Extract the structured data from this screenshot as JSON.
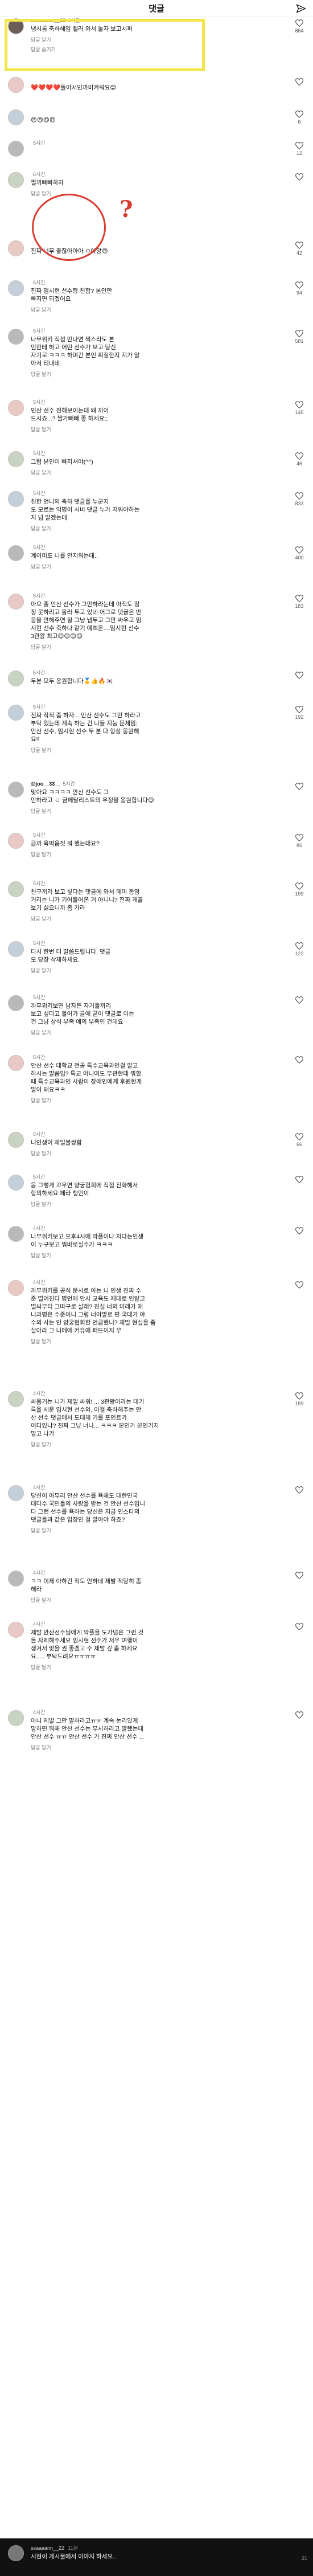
{
  "header": {
    "title": "댓글"
  },
  "side_icons": [
    "♡",
    "💬",
    "↻",
    "…"
  ],
  "comments": [
    {
      "user": "ssaaaann__22",
      "time": "6시간",
      "text": "냉시롱 축하해임 뻘러 와서 놀자 보고시퍼",
      "reply": "답글 달기",
      "more": "답글 숨기기",
      "likes": "864",
      "avatar": "dark",
      "blur": false
    },
    {
      "user": "",
      "time": "",
      "text": "❤️❤️❤️❤️돌아서인까미켜워요😊",
      "reply": "",
      "more": "",
      "likes": "",
      "avatar": "pink",
      "blur": false
    },
    {
      "user": "",
      "time": "",
      "text": "😍😍😍😍",
      "reply": "",
      "more": "",
      "likes": "6",
      "avatar": "blue",
      "blur": false
    },
    {
      "user": "",
      "time": "5시간",
      "text": "",
      "reply": "",
      "more": "",
      "likes": "12",
      "avatar": "gray",
      "blur": true
    },
    {
      "user": "",
      "time": "6시간",
      "text": "찔끼빠빠하자",
      "reply": "답글 달기",
      "more": "",
      "likes": "",
      "avatar": "green",
      "blur": true
    },
    {
      "user": "",
      "time": "",
      "text": "진짜 너무 좋잖아아아 ㅇ아앙😍",
      "reply": "",
      "more": "",
      "likes": "42",
      "avatar": "pink",
      "blur": true
    },
    {
      "user": "",
      "time": "6시간",
      "text": "진짜 임시현 선수랑 친함? 본인만\n빠지면 되겠어요",
      "reply": "답글 달기",
      "more": "",
      "likes": "94",
      "avatar": "blue",
      "blur": true
    },
    {
      "user": "",
      "time": "5시간",
      "text": "나무위키 직접 만나면 찍스라도 본\n인한테 하고 어떤 선수가 보고 당신\n자기로 ㅋㅋㅋ 하며간 본인 찌질한지 지가 알\n아서 티내네",
      "reply": "답글 달기",
      "more": "",
      "likes": "581",
      "avatar": "gray",
      "blur": true
    },
    {
      "user": "",
      "time": "5시간",
      "text": "인산 선수 진해보이는데 왜 끼어\n드시죠...? 짤가빼빼 좋 하세요;;",
      "reply": "답글 달기",
      "more": "",
      "likes": "145",
      "avatar": "pink",
      "blur": true
    },
    {
      "user": "",
      "time": "5시간",
      "text": "그럼 본인이 빠지셔야(^^)",
      "reply": "답글 달기",
      "more": "",
      "likes": "46",
      "avatar": "green",
      "blur": true
    },
    {
      "user": "",
      "time": "5시간",
      "text": "친한 언니의 축하 댓글을 누군지\n도 모르는 익명이 시비 댓글 누가 지워야하는\n지 넘 알겠는데",
      "reply": "답글 달기",
      "more": "",
      "likes": "833",
      "avatar": "blue",
      "blur": true
    },
    {
      "user": "",
      "time": "5시간",
      "text": "계이미도 니를 안지워는데..",
      "reply": "답글 달기",
      "more": "",
      "likes": "400",
      "avatar": "gray",
      "blur": true
    },
    {
      "user": "",
      "time": "5시간",
      "text": "아오 졸 안산 선수가 그만하라는데 아직도 징\n징 못하리고 몰라 투고 있네 어그로 댓글은 반\n응을 안해주면 될 그냥 냅두고 그만 싸우고 임\n시현 선수 축하나 같기 예쁘은....임시현 선수\n3관왕 최고😊😊😊😊",
      "reply": "답글 달기",
      "more": "",
      "likes": "183",
      "avatar": "pink",
      "blur": true
    },
    {
      "user": "",
      "time": "5시간",
      "text": "두분 모두 응원합니다🥇👍🔥🇰🇷",
      "reply": "",
      "more": "",
      "likes": "",
      "avatar": "green",
      "blur": true
    },
    {
      "user": "",
      "time": "5시간",
      "text": "진짜 작작 좀 하자... 안산 선수도 그만 하라고\n부탁 했는데 계속 하는 건 니들 지능 문제임;\n안산 선수, 임시현 선수 두 분 다 항상 응원해\n요!!",
      "reply": "답글 달기",
      "more": "",
      "likes": "192",
      "avatar": "blue",
      "blur": true
    },
    {
      "user": "@joo__33__",
      "time": "5시간",
      "text": "맞아요 ㅋㅋㅋㅋ 안산 선수도 그\n만하라고 ☺ 금메달리스트의 우정을 응원합니다😊",
      "reply": "답글 달기",
      "more": "",
      "likes": "",
      "avatar": "gray",
      "blur": false
    },
    {
      "user": "",
      "time": "5시간",
      "text": "금까 욕먹음짓 뭐 했는데요?",
      "reply": "답글 달기",
      "more": "",
      "likes": "86",
      "avatar": "pink",
      "blur": true
    },
    {
      "user": "",
      "time": "5시간",
      "text": "친구끼리 보고 싶다는 댓글에 와서 페미 동영\n거리는 니가 기어들어온 거 아니니? 진짜 게꼴\n보기 싫으니까 좀 가라",
      "reply": "답글 달기",
      "more": "",
      "likes": "199",
      "avatar": "green",
      "blur": true
    },
    {
      "user": "",
      "time": "5시간",
      "text": "다시 한번 더 말씀드립니다. 댓글\n모 당장 삭제하세요.",
      "reply": "답글 달기",
      "more": "",
      "likes": "122",
      "avatar": "blue",
      "blur": true
    },
    {
      "user": "",
      "time": "5시간",
      "text": "까무위키보면 남자든 자기들끼리\n보고 싶다고 들어가 글에 굳이 댓글로 이는\n건 그냥 상식 부족 예의 부족인 건데요",
      "reply": "답글 달기",
      "more": "",
      "likes": "",
      "avatar": "gray",
      "blur": true
    },
    {
      "user": "",
      "time": "5시간",
      "text": "안산 선수 대학교 전공 특수교육과인걸 알고\n하시는 말씀임? 특교 아니여도 무관한데 뭐할\n때 특수교육과인 사람이 장애인에게 후원한게\n말이 돼요ㅋㅋ",
      "reply": "답글 달기",
      "more": "",
      "likes": "",
      "avatar": "pink",
      "blur": true
    },
    {
      "user": "",
      "time": "5시간",
      "text": "니인생이 제일불쌍함",
      "reply": "답글 달기",
      "more": "",
      "likes": "66",
      "avatar": "green",
      "blur": true
    },
    {
      "user": "",
      "time": "5시간",
      "text": "음 그렇게 꼬우면 양궁협회에 직접 전화해서\n항의하세요 페라 챙인이",
      "reply": "답글 달기",
      "more": "",
      "likes": "",
      "avatar": "blue",
      "blur": true
    },
    {
      "user": "",
      "time": "4시간",
      "text": "나무위키보고 오후4시에 악플이나 처다는인생\n이 누구보고 뭐바로실수가 ㅋㅋㅋ",
      "reply": "답글 달기",
      "more": "",
      "likes": "",
      "avatar": "gray",
      "blur": true
    },
    {
      "user": "",
      "time": "4시간",
      "text": "까무위키를 공식 문서로 아는 니 인생 진짜 수\n준 떨어진다 명언에 안사 교육도 제대로 인받고\n벌써부터 그따구로 살래? 진심 너의 미래가 애\n니과명은 수준이니 그럼 너야말로 편 국대가 야\n수의 사는 인 양궁협회한 언급했니? 제발 현실을 좀\n살아라 그 니에에 커유에 퍼뜨이지 우",
      "reply": "답글 달기",
      "more": "",
      "likes": "",
      "avatar": "pink",
      "blur": true
    },
    {
      "user": "",
      "time": "4시간",
      "text": "싸움거는 니가 제일 싸워! ... 3관왕이라는 대기\n록을 세운 임시현 선수와, 이걸 축하해주는 안\n산 선수 댓글에서 도대체 기를 포인트가\n어디있냐? 진짜 그냥 너나... ㅋㅋㅋ 본인가 본인거지\n말고 나가",
      "reply": "답글 달기",
      "more": "",
      "likes": "159",
      "avatar": "green",
      "blur": true
    },
    {
      "user": "",
      "time": "4시간",
      "text": "당신이 아무리 안산 선수를 욕해도 대한민국\n대다수 국민들의 사랑을 받는 건 안산 선수입니\n다 그런 선수를 욕하는 당신은 지금 인스타의\n댓글들과 같은 입장인 걸 알아야 하죠?",
      "reply": "답글 달기",
      "more": "",
      "likes": "",
      "avatar": "blue",
      "blur": true
    },
    {
      "user": "",
      "time": "4시간",
      "text": "ㅋㅋ 이제 아하긴 적도 안하네 제발 적당히 좀\n해라",
      "reply": "답글 달기",
      "more": "",
      "likes": "",
      "avatar": "gray",
      "blur": true
    },
    {
      "user": "",
      "time": "4시간",
      "text": "제발 안산선수님에게 악플을 도가넘은 그런 것\n들 자제해주세요 임시현 선수가 저우 여행이\n생겨서 맞을 권 좋겠고 수 제발 깊 좀 하세요\n요..... 부탁드려요ㅠㅠㅠㅠ",
      "reply": "답글 달기",
      "more": "",
      "likes": "",
      "avatar": "pink",
      "blur": true
    },
    {
      "user": "",
      "time": "4시간",
      "text": "아니 제발 그만 말하라고ㅠㅠ 계속 논리있게\n말하면 뭐해 안산 선수는 무시하라고 말했는데\n안산 선수 ㅠㅠ 안산 선수 가 진짜 안산 선수 ...",
      "reply": "답글 달기",
      "more": "",
      "likes": "",
      "avatar": "green",
      "blur": true
    }
  ],
  "bottom_bar": {
    "user": "ssaaaann__22",
    "time": "11분",
    "text": "시현이 게시물에서 이야지 하세요..",
    "likes": "21"
  }
}
